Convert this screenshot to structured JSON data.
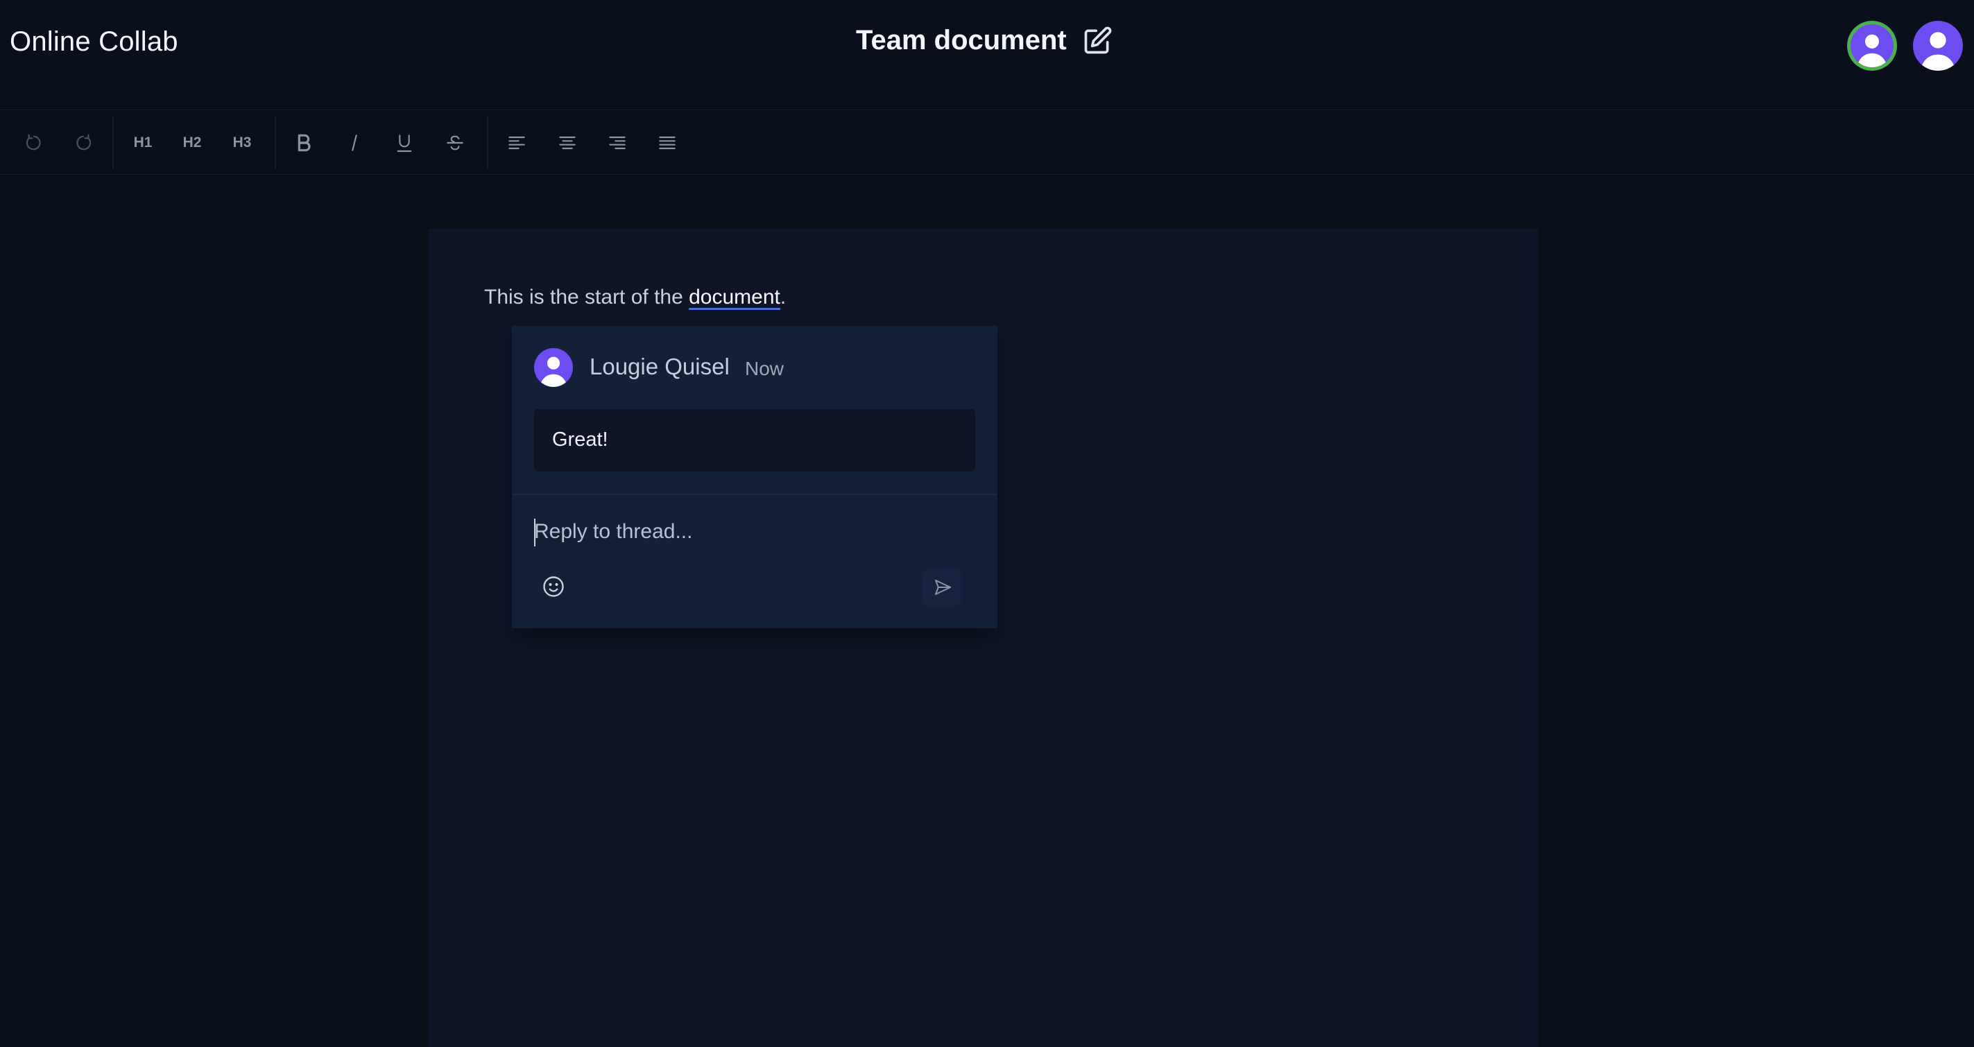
{
  "app": {
    "title": "Online Collab"
  },
  "document": {
    "title": "Team document",
    "text_before": "This is the start of the ",
    "linked_text": "document",
    "text_after": "."
  },
  "presence": {
    "avatars": [
      "user-avatar",
      "user-avatar"
    ]
  },
  "toolbar": {
    "h1": "H1",
    "h2": "H2",
    "h3": "H3",
    "icons": [
      "undo-icon",
      "redo-icon",
      "bold-icon",
      "italic-icon",
      "underline-icon",
      "strikethrough-icon",
      "align-left-icon",
      "align-center-icon",
      "align-right-icon",
      "align-justify-icon"
    ]
  },
  "comment": {
    "author": "Lougie Quisel",
    "time": "Now",
    "body": "Great!",
    "reply_placeholder": "Reply to thread..."
  },
  "colors": {
    "background": "#0a0f1c",
    "accent": "#6d4df2",
    "online_ring": "#4caf50"
  }
}
